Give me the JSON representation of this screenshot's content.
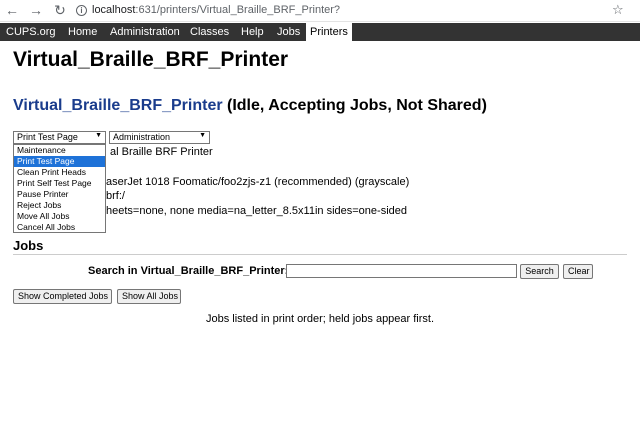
{
  "browser": {
    "back_icon": "back-arrow-icon",
    "forward_icon": "forward-arrow-icon",
    "reload_icon": "reload-icon",
    "url_host": "localhost",
    "url_rest": ":631/printers/Virtual_Braille_BRF_Printer?",
    "bookmark_icon": "star-icon"
  },
  "nav": {
    "tabs": [
      "CUPS.org",
      "Home",
      "Administration",
      "Classes",
      "Help",
      "Jobs",
      "Printers"
    ],
    "active": "Printers"
  },
  "page": {
    "title": "Virtual_Braille_BRF_Printer",
    "printer_link": "Virtual_Braille_BRF_Printer",
    "printer_state": " (Idle, Accepting Jobs, Not Shared)"
  },
  "controls": {
    "maintenance_selected": "Print Test Page",
    "administration_selected": "Administration",
    "maintenance_options": [
      "Maintenance",
      "Print Test Page",
      "Clean Print Heads",
      "Print Self Test Page",
      "Pause Printer",
      "Reject Jobs",
      "Move All Jobs",
      "Cancel All Jobs"
    ]
  },
  "info": {
    "description_partial": "al Braille BRF Printer",
    "driver_partial": "aserJet 1018 Foomatic/foo2zjs-z1 (recommended) (grayscale)",
    "connection_partial": "brf:/",
    "defaults_partial": "heets=none, none media=na_letter_8.5x11in sides=one-sided"
  },
  "jobs": {
    "heading": "Jobs",
    "search_label": "Search in Virtual_Braille_BRF_Printer:",
    "search_value": "",
    "search_button": "Search",
    "clear_button": "Clear",
    "show_completed": "Show Completed Jobs",
    "show_all": "Show All Jobs",
    "note": "Jobs listed in print order; held jobs appear first."
  }
}
